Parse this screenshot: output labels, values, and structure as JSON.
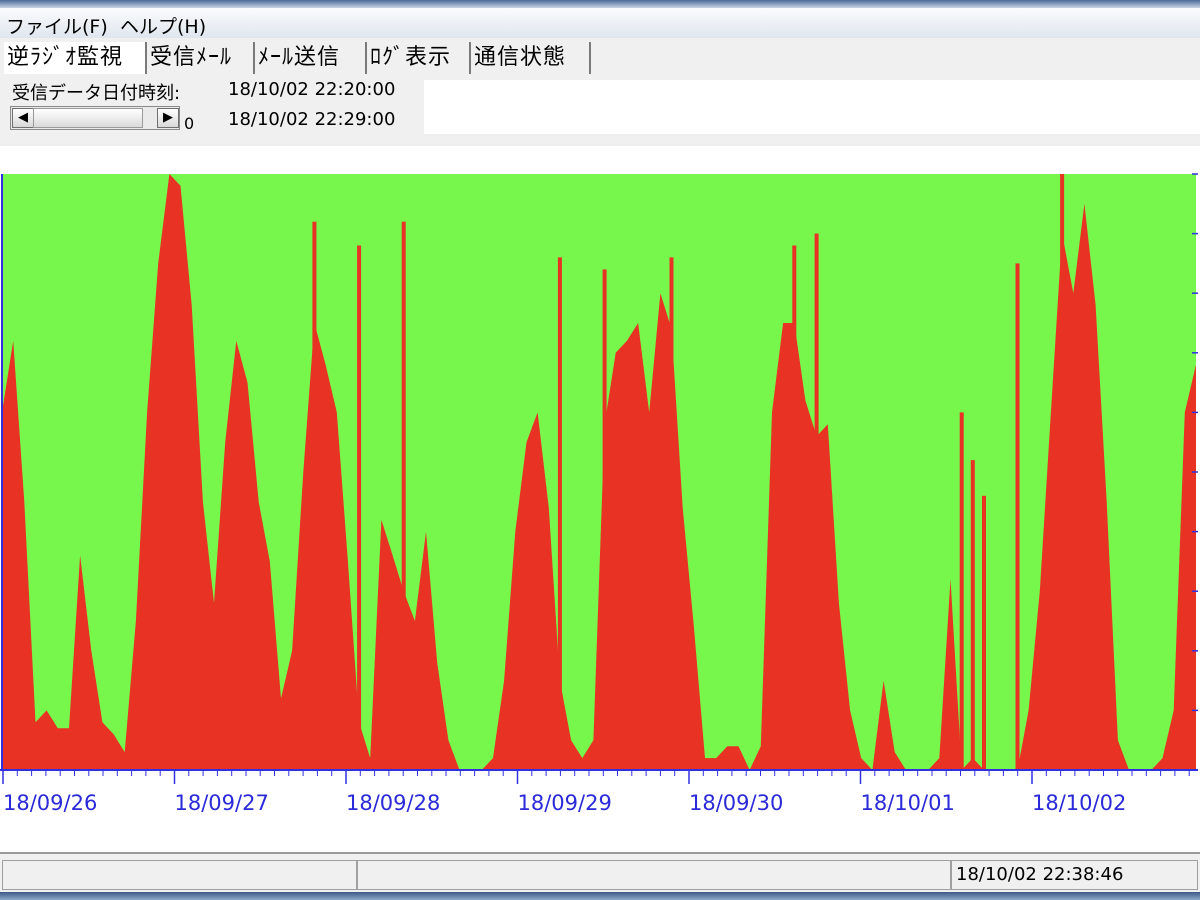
{
  "menu": {
    "file": "ファイル(F)",
    "help": "ヘルプ(H)"
  },
  "tabs": [
    {
      "label": "逆ﾗｼﾞｵ監視",
      "active": true
    },
    {
      "label": "受信ﾒｰﾙ",
      "active": false
    },
    {
      "label": "ﾒｰﾙ送信",
      "active": false
    },
    {
      "label": "ﾛｸﾞ表示",
      "active": false
    },
    {
      "label": "通信状態",
      "active": false
    }
  ],
  "info": {
    "received_label": "受信データ日付時刻:",
    "time_from": "18/10/02 22:20:00",
    "time_to": "18/10/02 22:29:00",
    "scroll_value": "0"
  },
  "scrollbar": {
    "left_icon": "◀",
    "right_icon": "▶"
  },
  "chart_data": {
    "type": "area",
    "x_labels": [
      "18/09/26",
      "18/09/27",
      "18/09/28",
      "18/09/29",
      "18/09/30",
      "18/10/01",
      "18/10/02"
    ],
    "ylim": [
      0,
      100
    ],
    "colors": {
      "upper": "#77f74c",
      "lower": "#e83223",
      "axis": "#3030e0",
      "label": "#2a2ad8"
    },
    "series": [
      {
        "values": [
          60,
          72,
          45,
          8,
          10,
          7,
          7,
          36,
          20,
          8,
          6,
          3,
          25,
          60,
          85,
          100,
          98,
          78,
          45,
          28,
          55,
          72,
          65,
          45,
          35,
          12,
          20,
          50,
          75,
          68,
          60,
          35,
          8,
          2,
          42,
          36,
          30,
          25,
          40,
          18,
          5,
          0,
          0,
          0,
          2,
          15,
          40,
          55,
          60,
          44,
          15,
          5,
          2,
          5,
          58,
          70,
          72,
          75,
          60,
          80,
          74,
          44,
          24,
          2,
          2,
          4,
          4,
          0,
          4,
          60,
          75,
          75,
          62,
          56,
          58,
          28,
          10,
          2,
          0,
          15,
          3,
          0,
          0,
          0,
          2,
          32,
          0,
          2,
          0,
          0,
          0,
          0,
          10,
          30,
          60,
          90,
          80,
          95,
          78,
          45,
          5,
          0,
          0,
          0,
          2,
          10,
          60,
          68
        ]
      }
    ],
    "spikes": [
      [
        28,
        92
      ],
      [
        32,
        88
      ],
      [
        36,
        92
      ],
      [
        50,
        86
      ],
      [
        54,
        84
      ],
      [
        60,
        86
      ],
      [
        71,
        88
      ],
      [
        73,
        90
      ],
      [
        86,
        60
      ],
      [
        87,
        52
      ],
      [
        88,
        46
      ],
      [
        91,
        85
      ],
      [
        95,
        100
      ]
    ]
  },
  "status": {
    "datetime": "18/10/02 22:38:46"
  }
}
